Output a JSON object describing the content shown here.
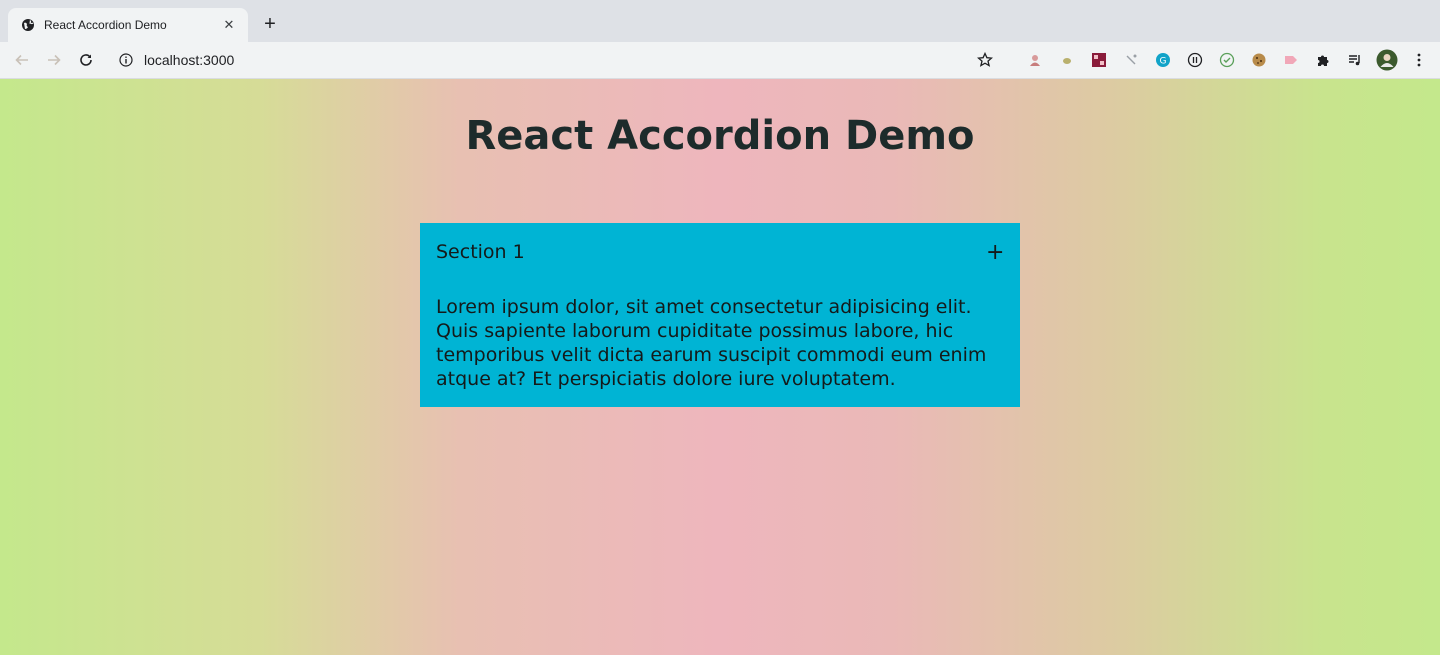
{
  "browser": {
    "tab_title": "React Accordion Demo",
    "tab_close": "✕",
    "new_tab": "+",
    "address": "localhost:3000",
    "icons": {
      "back": "arrow-left-icon",
      "forward": "arrow-right-icon",
      "reload": "reload-icon",
      "info": "info-icon",
      "bookmark": "star-icon",
      "extensions": "puzzle-icon",
      "media": "playlist-icon",
      "menu": "kebab-menu-icon"
    },
    "toolbar_color": "#f1f3f4",
    "tabstrip_color": "#dee1e6"
  },
  "page": {
    "title": "React Accordion Demo",
    "background_colors": [
      "#c4e88c",
      "#eeb6bd"
    ]
  },
  "accordion": {
    "accent": "#00b4d4",
    "sections": [
      {
        "title": "Section 1",
        "toggle": "+",
        "content": "Lorem ipsum dolor, sit amet consectetur adipisicing elit. Quis sapiente laborum cupiditate possimus labore, hic temporibus velit dicta earum suscipit commodi eum enim atque at? Et perspiciatis dolore iure voluptatem."
      }
    ]
  }
}
